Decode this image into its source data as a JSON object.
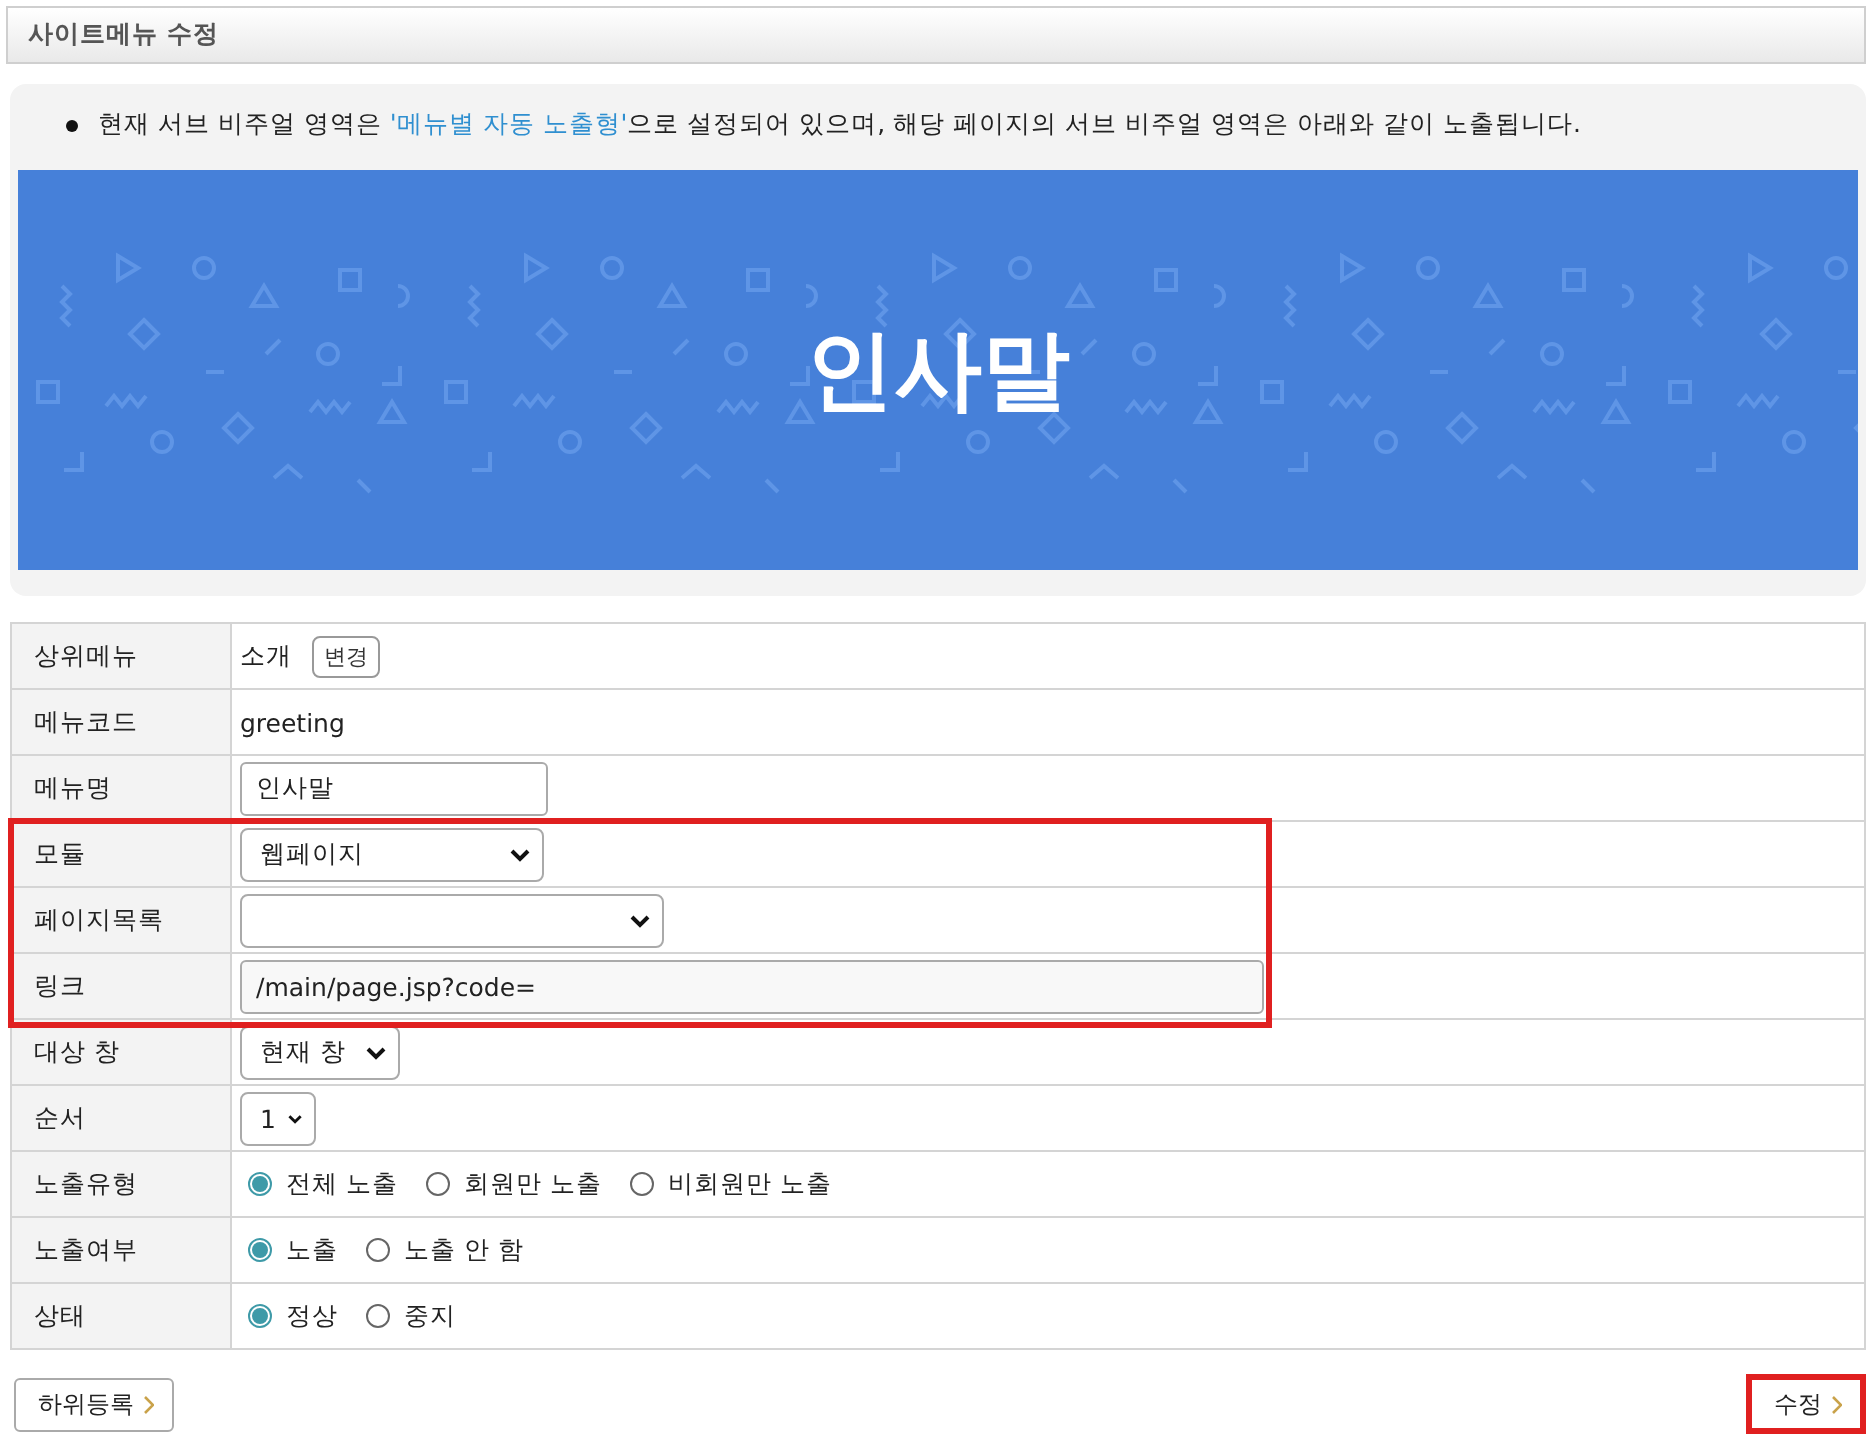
{
  "header": {
    "title": "사이트메뉴 수정"
  },
  "notice": {
    "text_before": "현재 서브 비주얼 영역은 ",
    "highlight": "'메뉴별 자동 노출형'",
    "text_after": "으로 설정되어 있으며, 해당 페이지의 서브 비주얼 영역은 아래와 같이 노출됩니다."
  },
  "banner": {
    "title": "인사말"
  },
  "rows": [
    {
      "label": "상위메뉴",
      "kind": "text",
      "value": "소개",
      "button": "변경",
      "highlighted": false
    },
    {
      "label": "메뉴코드",
      "kind": "text",
      "value": "greeting",
      "highlighted": false
    },
    {
      "label": "메뉴명",
      "kind": "input",
      "value": "인사말",
      "highlighted": false
    },
    {
      "label": "모듈",
      "kind": "select",
      "value": "웹페이지",
      "highlighted": true
    },
    {
      "label": "페이지목록",
      "kind": "select",
      "highlighted": true
    },
    {
      "label": "링크",
      "kind": "input",
      "value": "/main/page.jsp?code=",
      "highlighted": true
    },
    {
      "label": "대상 창",
      "kind": "select",
      "value": "현재 창",
      "highlighted": false
    },
    {
      "label": "순서",
      "kind": "select",
      "value": "1",
      "highlighted": false
    },
    {
      "label": "노출유형",
      "kind": "radio",
      "options": [
        {
          "label": "전체 노출",
          "selected": true
        },
        {
          "label": "회원만 노출",
          "selected": false
        },
        {
          "label": "비회원만 노출",
          "selected": false
        }
      ],
      "highlighted": false
    },
    {
      "label": "노출여부",
      "kind": "radio",
      "options": [
        {
          "label": "노출",
          "selected": true
        },
        {
          "label": "노출 안 함",
          "selected": false
        }
      ],
      "highlighted": false
    },
    {
      "label": "상태",
      "kind": "radio",
      "options": [
        {
          "label": "정상",
          "selected": true
        },
        {
          "label": "중지",
          "selected": false
        }
      ],
      "highlighted": false
    }
  ],
  "buttons": [
    {
      "label": "하위등록",
      "highlighted": false
    },
    {
      "label": "수정",
      "highlighted": true
    }
  ]
}
